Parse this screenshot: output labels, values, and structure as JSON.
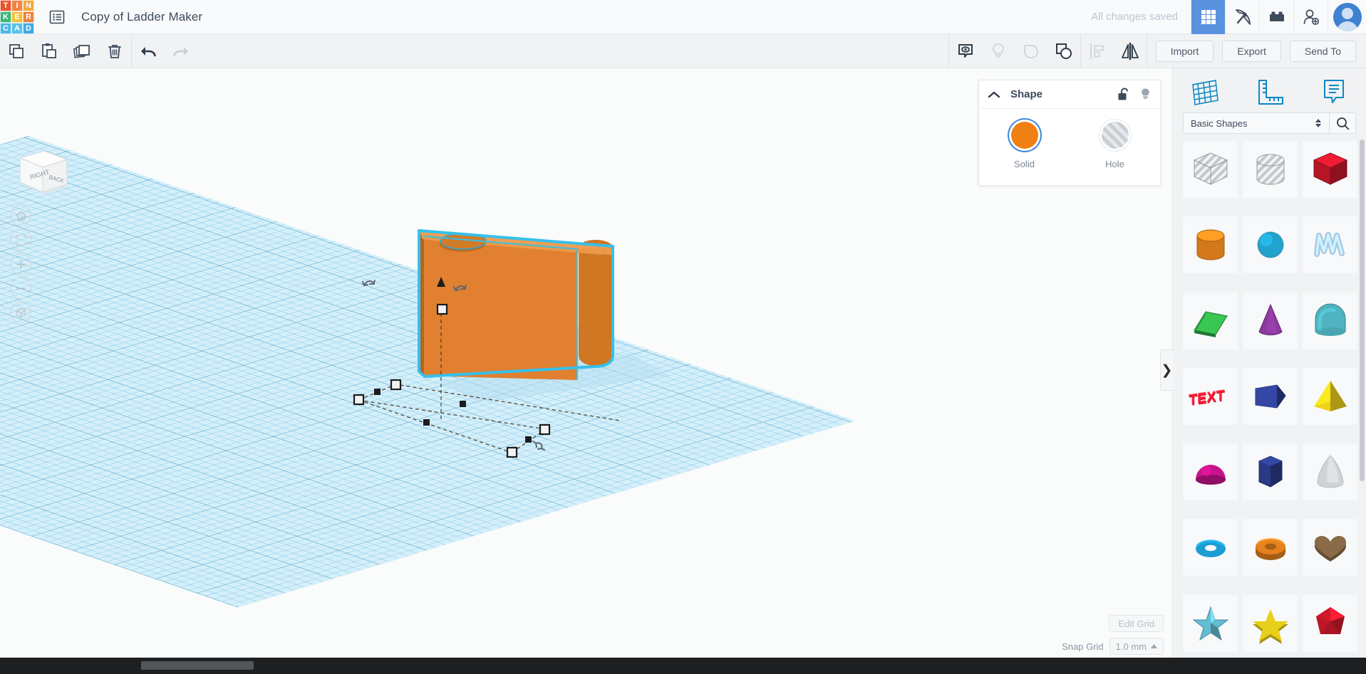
{
  "app": {
    "logo_letters": [
      "T",
      "I",
      "N",
      "K",
      "E",
      "R",
      "C",
      "A",
      "D"
    ],
    "logo_colors": [
      "#e8542f",
      "#f08447",
      "#f4a83a",
      "#3bb878",
      "#f3c13a",
      "#ef7f3c",
      "#4db7e8",
      "#59c0e8",
      "#3fa9e0"
    ],
    "document_title": "Copy of Ladder Maker",
    "menu_icon": "list-menu-icon"
  },
  "topbar": {
    "save_status": "All changes saved",
    "icons": [
      {
        "name": "grid-apps-icon",
        "active": true
      },
      {
        "name": "pickaxe-icon",
        "active": false
      },
      {
        "name": "lego-brick-icon",
        "active": false
      },
      {
        "name": "add-person-icon",
        "active": false
      }
    ],
    "avatar_name": "user-avatar"
  },
  "toolbar": {
    "left_tools": [
      {
        "name": "copy-button",
        "icon": "copy-icon",
        "enabled": true
      },
      {
        "name": "paste-button",
        "icon": "clipboard-paste-icon",
        "enabled": true
      },
      {
        "name": "duplicate-button",
        "icon": "duplicate-icon",
        "enabled": true
      },
      {
        "name": "delete-button",
        "icon": "trash-icon",
        "enabled": true
      },
      {
        "name": "undo-button",
        "icon": "undo-arrow-icon",
        "enabled": true
      },
      {
        "name": "redo-button",
        "icon": "redo-arrow-icon",
        "enabled": false
      }
    ],
    "mid_tools": [
      {
        "name": "notes-button",
        "icon": "eye-note-icon",
        "enabled": true
      },
      {
        "name": "light-button",
        "icon": "lightbulb-icon",
        "enabled": false
      },
      {
        "name": "shape-generator-button",
        "icon": "blob-shape-icon",
        "enabled": false
      },
      {
        "name": "group-button",
        "icon": "group-shapes-icon",
        "enabled": true
      },
      {
        "name": "align-button",
        "icon": "align-icon",
        "enabled": false
      },
      {
        "name": "mirror-button",
        "icon": "mirror-flip-icon",
        "enabled": true
      }
    ],
    "import_label": "Import",
    "export_label": "Export",
    "sendto_label": "Send To"
  },
  "canvas": {
    "viewcube": {
      "face_right": "RIGHT",
      "face_back": "BACK",
      "face_top": ""
    },
    "nav_buttons": [
      {
        "name": "home-view-button",
        "icon": "home-icon"
      },
      {
        "name": "fit-to-view-button",
        "icon": "fit-frame-icon"
      },
      {
        "name": "zoom-in-button",
        "icon": "plus-icon"
      },
      {
        "name": "zoom-out-button",
        "icon": "minus-icon"
      },
      {
        "name": "perspective-toggle-button",
        "icon": "cube-icon"
      }
    ],
    "object": {
      "name": "selected-orange-box",
      "fill": "#e08030",
      "fill_top": "#ea9544",
      "fill_side": "#d06f22",
      "outline": "#35c0ec",
      "hole_shape": "cylinder-cutout"
    },
    "workplane_color": "#d4effa",
    "edit_grid_label": "Edit Grid",
    "snap_grid_label": "Snap Grid",
    "snap_grid_value": "1.0 mm"
  },
  "inspector": {
    "title": "Shape",
    "collapse_icon": "chevron-up-icon",
    "lock_icon": "unlock-icon",
    "light_icon": "lightbulb-icon",
    "solid_label": "Solid",
    "hole_label": "Hole",
    "solid_color": "#f08013",
    "selected": "Solid"
  },
  "sidebar": {
    "tabs": [
      {
        "name": "tab-workplane",
        "icon": "grid-plane-icon"
      },
      {
        "name": "tab-ruler",
        "icon": "ruler-icon"
      },
      {
        "name": "tab-note",
        "icon": "note-icon"
      }
    ],
    "category_value": "Basic Shapes",
    "search_icon": "search-icon",
    "panel_toggle_icon": "chevron-right-icon",
    "shapes": [
      {
        "label": "Box Hole",
        "name": "shape-box-hole",
        "kind": "cube",
        "color": "#d2d6da",
        "hatched": true
      },
      {
        "label": "Cylinder Hole",
        "name": "shape-cylinder-hole",
        "kind": "cylinder",
        "color": "#d2d6da",
        "hatched": true
      },
      {
        "label": "Box",
        "name": "shape-box",
        "kind": "cube",
        "color": "#c4172a",
        "hatched": false
      },
      {
        "label": "Cylinder",
        "name": "shape-cylinder",
        "kind": "cylinder",
        "color": "#e5821d",
        "hatched": false
      },
      {
        "label": "Sphere",
        "name": "shape-sphere",
        "kind": "sphere",
        "color": "#21a3cd",
        "hatched": false
      },
      {
        "label": "Scribble",
        "name": "shape-scribble",
        "kind": "scribble",
        "color": "#a9c8e2",
        "hatched": false
      },
      {
        "label": "Roof",
        "name": "shape-roof",
        "kind": "wedge",
        "color": "#2da343",
        "hatched": false
      },
      {
        "label": "Cone",
        "name": "shape-cone",
        "kind": "cone",
        "color": "#8c3a9e",
        "hatched": false
      },
      {
        "label": "Round Roof",
        "name": "shape-round-roof",
        "kind": "halfcyl",
        "color": "#4fb3c0",
        "hatched": false
      },
      {
        "label": "Text",
        "name": "shape-text",
        "kind": "text",
        "color": "#d6172c",
        "hatched": false
      },
      {
        "label": "Polygon",
        "name": "shape-polygon",
        "kind": "polyblock",
        "color": "#2b3a87",
        "hatched": false
      },
      {
        "label": "Pyramid",
        "name": "shape-pyramid",
        "kind": "pyramid",
        "color": "#f0d21a",
        "hatched": false
      },
      {
        "label": "Half Sphere",
        "name": "shape-half-sphere",
        "kind": "dome",
        "color": "#c8148c",
        "hatched": false
      },
      {
        "label": "Hex Prism",
        "name": "shape-hex-prism",
        "kind": "hexprism",
        "color": "#2b3a87",
        "hatched": false
      },
      {
        "label": "Paraboloid",
        "name": "shape-paraboloid",
        "kind": "parab",
        "color": "#cfd3d6",
        "hatched": false
      },
      {
        "label": "Torus",
        "name": "shape-torus",
        "kind": "torus",
        "color": "#1c9ed4",
        "hatched": false
      },
      {
        "label": "Tube",
        "name": "shape-tube",
        "kind": "tube",
        "color": "#e5821d",
        "hatched": false
      },
      {
        "label": "Heart",
        "name": "shape-heart",
        "kind": "heart",
        "color": "#8a6a47",
        "hatched": false
      },
      {
        "label": "Star Gem",
        "name": "shape-star-gem",
        "kind": "star3d",
        "color": "#63bed4",
        "hatched": false
      },
      {
        "label": "Star",
        "name": "shape-star",
        "kind": "star",
        "color": "#e8cf1b",
        "hatched": false
      },
      {
        "label": "Polyhedron",
        "name": "shape-polyhedron",
        "kind": "gem",
        "color": "#cf1a2b",
        "hatched": false
      }
    ]
  }
}
